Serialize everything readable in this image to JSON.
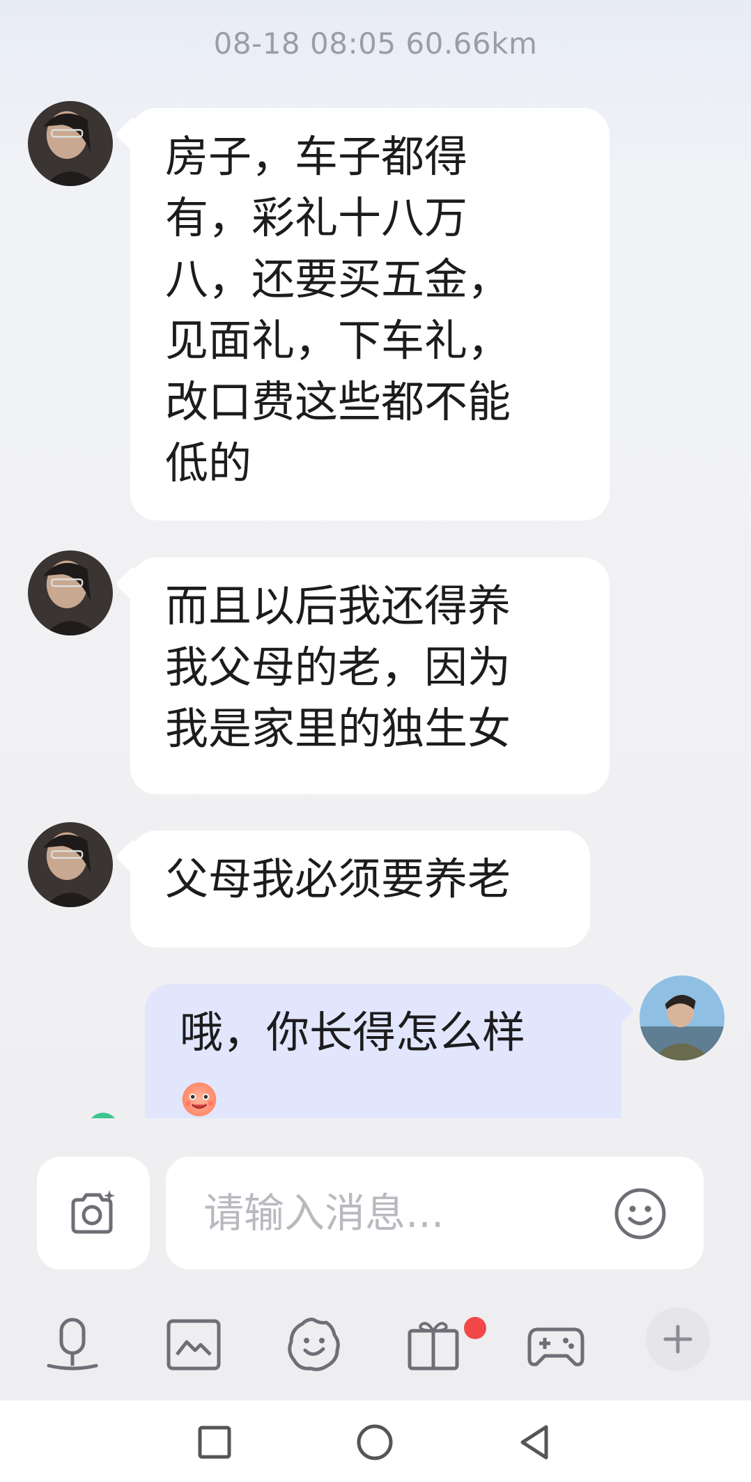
{
  "chat": {
    "timestamp": "08-18 08:05  60.66km",
    "messages": [
      {
        "sender": "other",
        "lines": [
          "房子，车子都得",
          "有，彩礼十八万",
          "八，还要买五金，",
          "见面礼，下车礼，",
          "改口费这些都不能",
          "低的"
        ]
      },
      {
        "sender": "other",
        "lines": [
          "而且以后我还得养",
          "我父母的老，因为",
          "我是家里的独生女"
        ]
      },
      {
        "sender": "other",
        "lines": [
          "父母我必须要养老"
        ]
      },
      {
        "sender": "me",
        "lines": [
          "哦，你长得怎么样"
        ],
        "emoji": "smiling-face-emoji"
      }
    ]
  },
  "input": {
    "placeholder": "请输入消息...",
    "value": ""
  },
  "icons": {
    "camera": "camera-icon",
    "emoji": "smiley-icon",
    "voice": "voice-icon",
    "image": "image-icon",
    "sticker": "sticker-icon",
    "gift": "gift-icon",
    "game": "gamepad-icon",
    "plus": "plus-icon"
  },
  "colors": {
    "other_bubble": "#ffffff",
    "my_bubble": "#e1e6fc",
    "badge": "#f04848",
    "icon": "#6e6e76"
  }
}
